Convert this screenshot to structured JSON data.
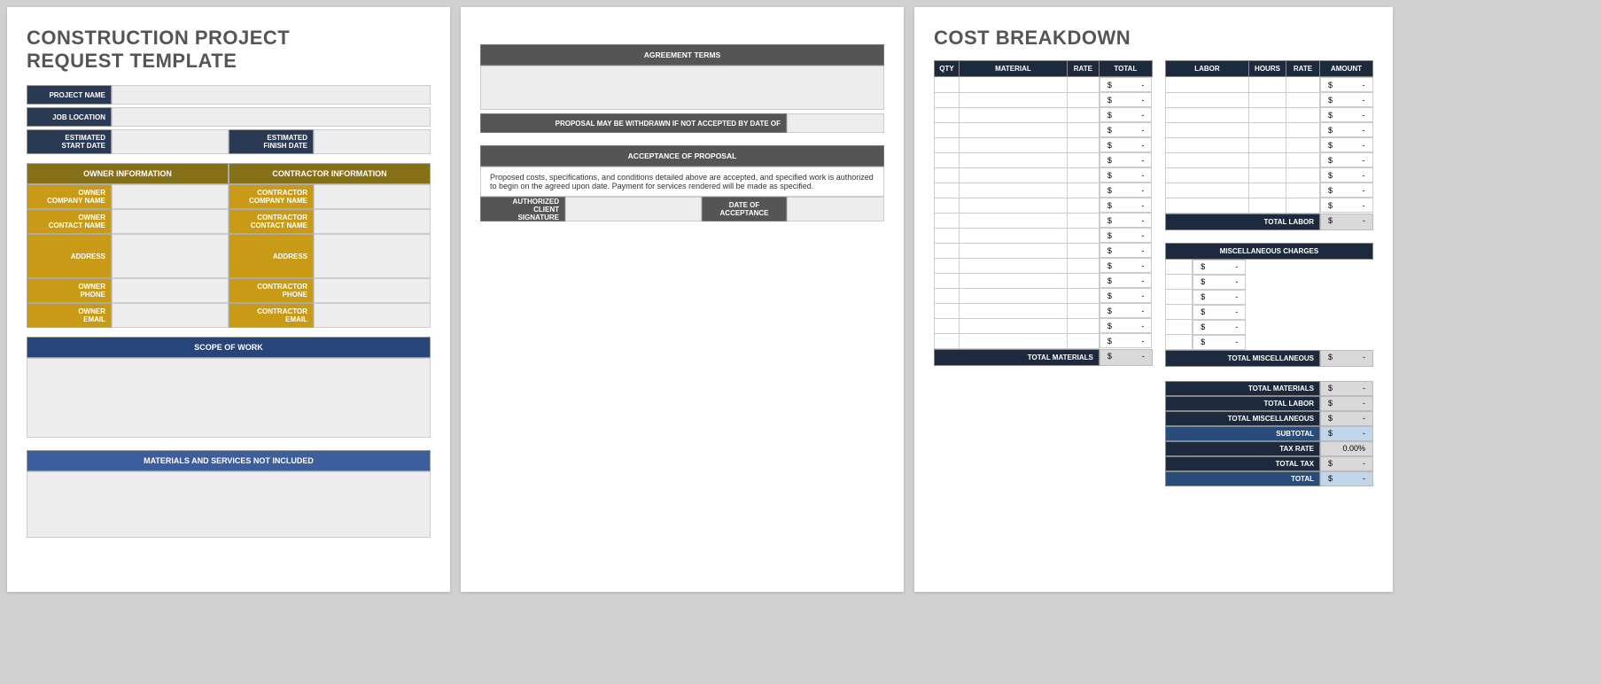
{
  "page1": {
    "title_line1": "CONSTRUCTION PROJECT",
    "title_line2": "REQUEST TEMPLATE",
    "project_name_label": "PROJECT NAME",
    "job_location_label": "JOB LOCATION",
    "est_start_label_1": "ESTIMATED",
    "est_start_label_2": "START DATE",
    "est_finish_label_1": "ESTIMATED",
    "est_finish_label_2": "FINISH DATE",
    "owner_info_header": "OWNER INFORMATION",
    "contractor_info_header": "CONTRACTOR INFORMATION",
    "owner_company_1": "OWNER",
    "owner_company_2": "COMPANY NAME",
    "owner_contact_1": "OWNER",
    "owner_contact_2": "CONTACT NAME",
    "owner_address": "ADDRESS",
    "owner_phone_1": "OWNER",
    "owner_phone_2": "PHONE",
    "owner_email_1": "OWNER",
    "owner_email_2": "EMAIL",
    "contractor_company_1": "CONTRACTOR",
    "contractor_company_2": "COMPANY NAME",
    "contractor_contact_1": "CONTRACTOR",
    "contractor_contact_2": "CONTACT NAME",
    "contractor_address": "ADDRESS",
    "contractor_phone_1": "CONTRACTOR",
    "contractor_phone_2": "PHONE",
    "contractor_email": "CONTRACTOR EMAIL",
    "scope_header": "SCOPE OF WORK",
    "materials_header": "MATERIALS AND SERVICES NOT INCLUDED"
  },
  "page2": {
    "agreement_header": "AGREEMENT TERMS",
    "withdraw_label": "PROPOSAL MAY BE WITHDRAWN IF NOT ACCEPTED BY DATE OF",
    "acceptance_header": "ACCEPTANCE OF PROPOSAL",
    "acceptance_text": "Proposed costs, specifications, and conditions detailed above are accepted, and specified work is authorized to begin on the agreed upon date.  Payment for services rendered will be made as specified.",
    "sig_label_1": "AUTHORIZED CLIENT",
    "sig_label_2": "SIGNATURE",
    "date_label": "DATE OF ACCEPTANCE"
  },
  "page3": {
    "title": "COST BREAKDOWN",
    "materials": {
      "headers": [
        "QTY",
        "MATERIAL",
        "RATE",
        "TOTAL"
      ],
      "rows": 18,
      "total_label": "TOTAL MATERIALS",
      "dollar": "$",
      "dash": "-"
    },
    "labor": {
      "headers": [
        "LABOR",
        "HOURS",
        "RATE",
        "AMOUNT"
      ],
      "rows": 9,
      "total_label": "TOTAL LABOR"
    },
    "misc": {
      "header": "MISCELLANEOUS CHARGES",
      "rows": 6,
      "total_label": "TOTAL MISCELLANEOUS"
    },
    "summary": {
      "total_materials": "TOTAL MATERIALS",
      "total_labor": "TOTAL LABOR",
      "total_misc": "TOTAL MISCELLANEOUS",
      "subtotal": "SUBTOTAL",
      "tax_rate": "TAX RATE",
      "tax_rate_val": "0.00%",
      "total_tax": "TOTAL TAX",
      "total": "TOTAL"
    }
  }
}
